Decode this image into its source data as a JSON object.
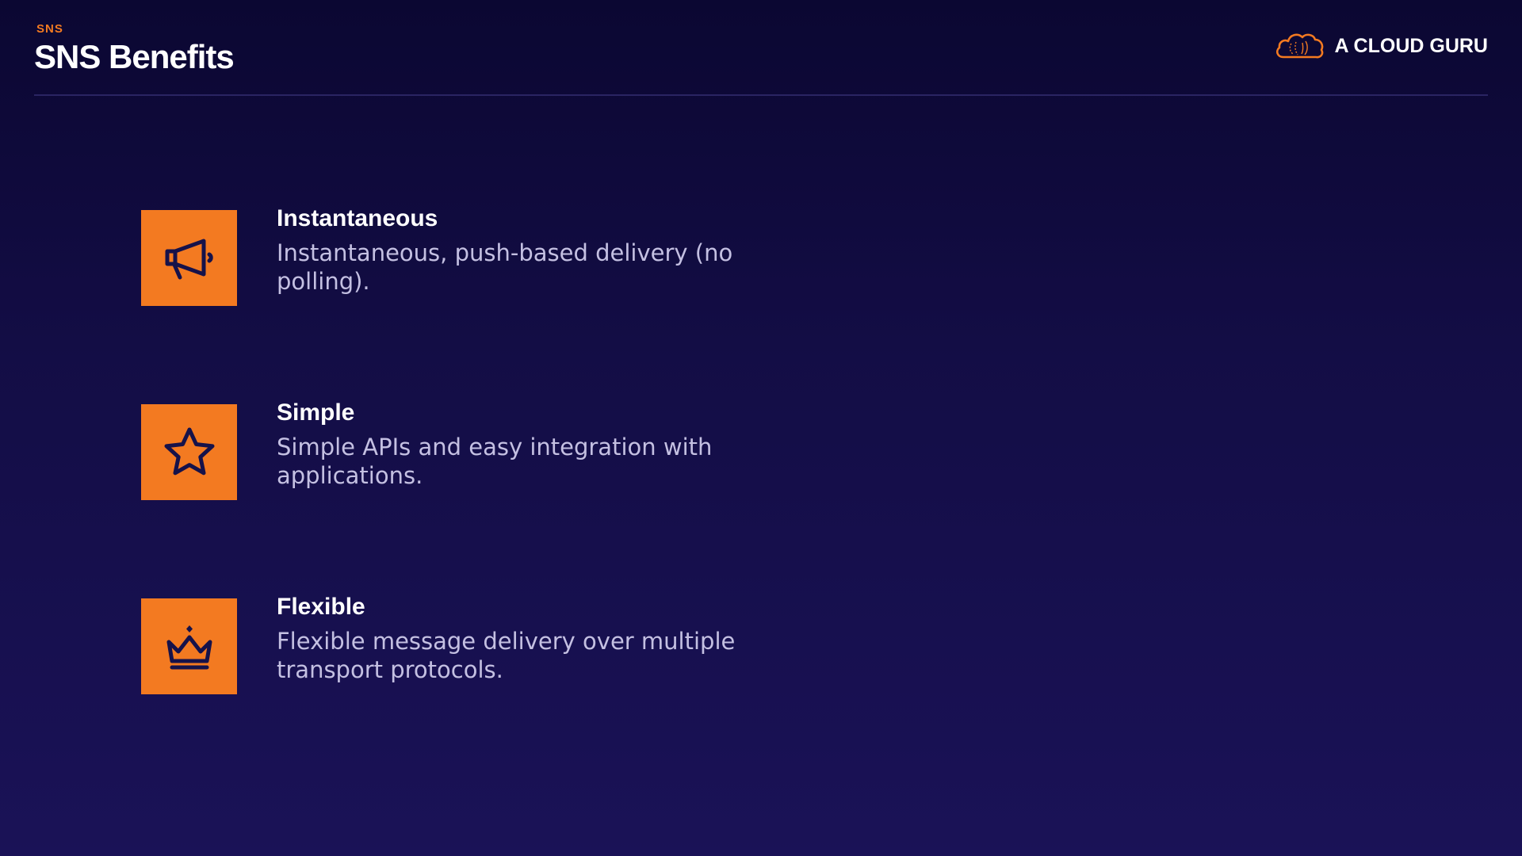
{
  "header": {
    "eyebrow": "SNS",
    "title": "SNS Benefits"
  },
  "brand": {
    "name": "A CLOUD GURU",
    "logo_icon": "cloud-logo-icon"
  },
  "colors": {
    "accent": "#f37a21",
    "icon_stroke": "#16124a",
    "background_top": "#0b0732",
    "background_bottom": "#1a1257",
    "body_text": "#c4c0e2"
  },
  "benefits": [
    {
      "icon": "megaphone-icon",
      "title": "Instantaneous",
      "description": "Instantaneous, push-based delivery (no polling)."
    },
    {
      "icon": "star-icon",
      "title": "Simple",
      "description": "Simple APIs and easy integration with applications."
    },
    {
      "icon": "crown-icon",
      "title": "Flexible",
      "description": "Flexible message delivery over multiple transport protocols."
    }
  ]
}
